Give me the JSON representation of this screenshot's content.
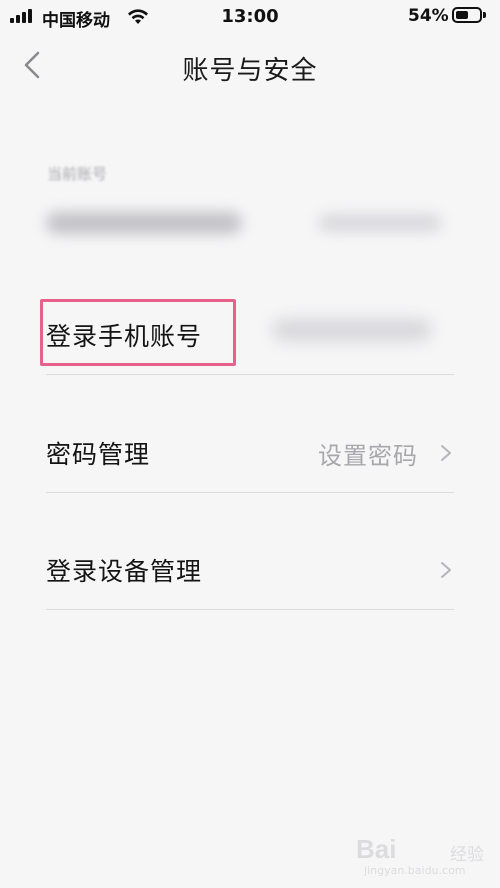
{
  "status_bar": {
    "carrier": "中国移动",
    "time": "13:00",
    "battery_percent": "54%",
    "battery_level": 0.54
  },
  "nav": {
    "title": "账号与安全",
    "back_icon": "chevron-left-icon"
  },
  "section": {
    "label": "当前账号"
  },
  "rows": [
    {
      "label": "登录手机账号",
      "value": ""
    },
    {
      "label": "密码管理",
      "value": "设置密码"
    },
    {
      "label": "登录设备管理",
      "value": ""
    }
  ],
  "annotation": {
    "highlight_color": "#e8618c"
  },
  "watermark": {
    "brand": "Bai",
    "sub": "经验",
    "url": "jingyan.baidu.com"
  }
}
